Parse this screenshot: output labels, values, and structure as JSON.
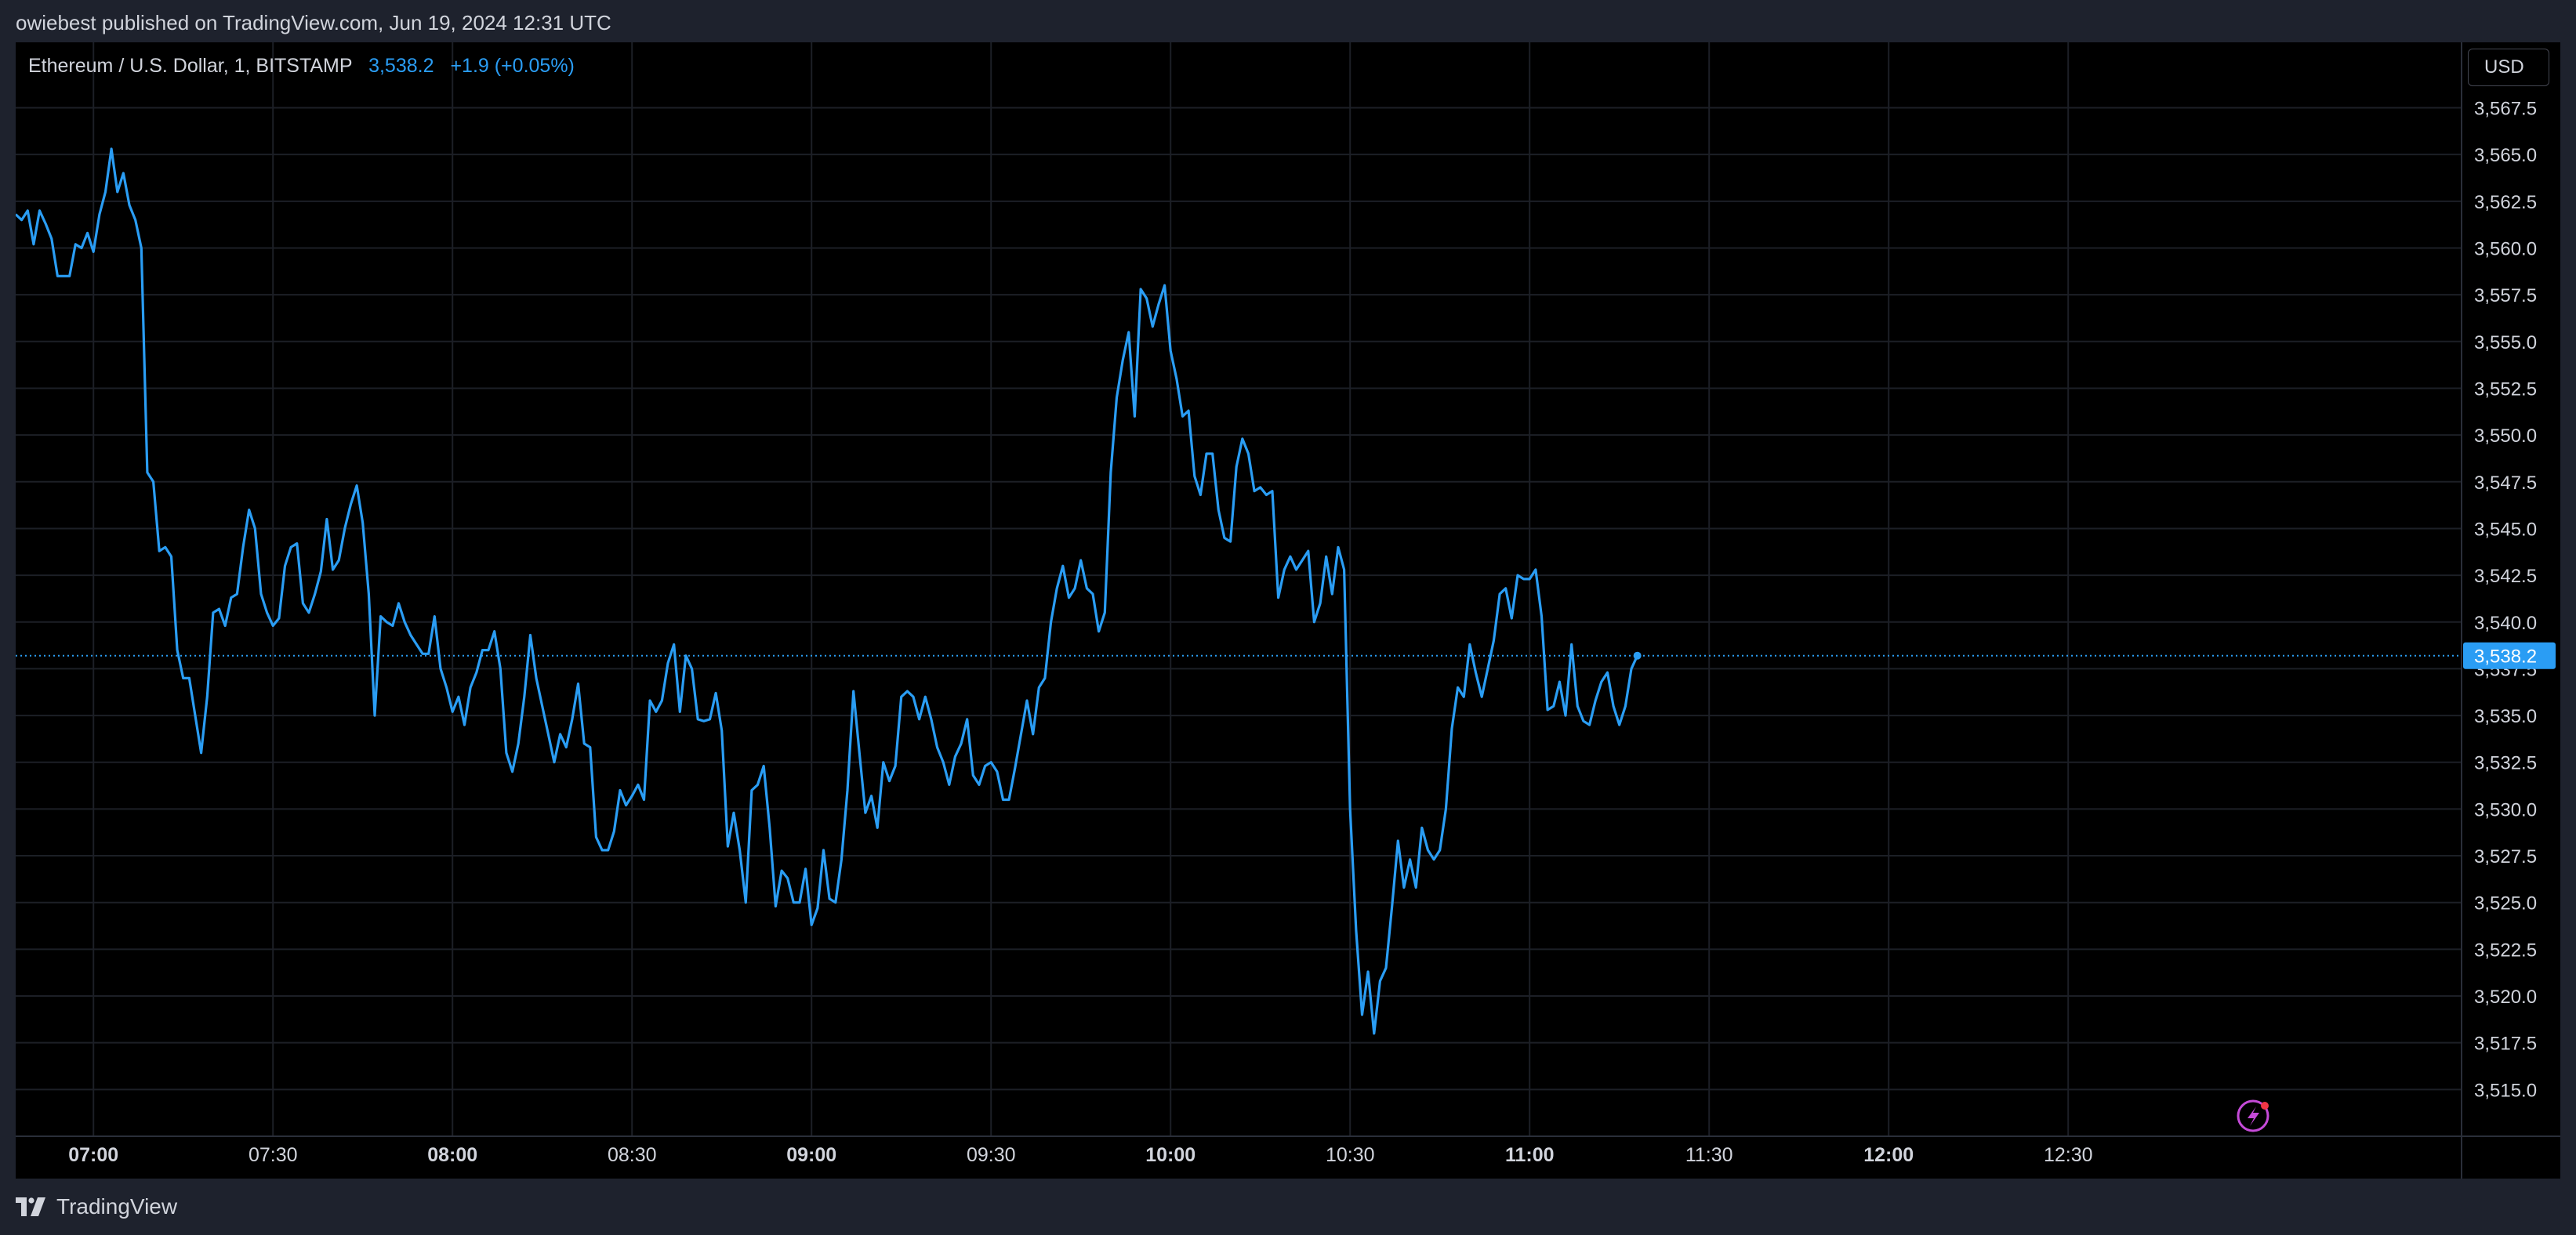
{
  "header": {
    "published_line": "owiebest published on TradingView.com, Jun 19, 2024 12:31 UTC"
  },
  "legend": {
    "symbol_text": "Ethereum / U.S. Dollar, 1, BITSTAMP",
    "last_price": "3,538.2",
    "change": "+1.9 (+0.05%)"
  },
  "currency_button": {
    "label": "USD"
  },
  "footer": {
    "brand": "TradingView",
    "logo_icon": "tradingview-logo-icon"
  },
  "colors": {
    "line": "#2a9df4",
    "price_tag_bg": "#2a9df4",
    "grid": "#1c1f26",
    "axis_text": "#d1d4dc",
    "background": "#000000",
    "frame": "#1e222d"
  },
  "chart_data": {
    "type": "line",
    "title": "",
    "xlabel": "",
    "ylabel": "",
    "x_unit": "minutes since 06:47 UTC",
    "ylim": [
      3512.5,
      3571
    ],
    "xlim": [
      0,
      271
    ],
    "grid": true,
    "y_ticks": [
      3515.0,
      3517.5,
      3520.0,
      3522.5,
      3525.0,
      3527.5,
      3530.0,
      3532.5,
      3535.0,
      3537.5,
      3540.0,
      3542.5,
      3545.0,
      3547.5,
      3550.0,
      3552.5,
      3555.0,
      3557.5,
      3560.0,
      3562.5,
      3565.0,
      3567.5
    ],
    "y_tick_labels": [
      "3,515.0",
      "3,517.5",
      "3,520.0",
      "3,522.5",
      "3,525.0",
      "3,527.5",
      "3,530.0",
      "3,532.5",
      "3,535.0",
      "3,537.5",
      "3,540.0",
      "3,542.5",
      "3,545.0",
      "3,547.5",
      "3,550.0",
      "3,552.5",
      "3,555.0",
      "3,557.5",
      "3,560.0",
      "3,562.5",
      "3,565.0",
      "3,567.5"
    ],
    "x_ticks": [
      {
        "label": "07:00",
        "minute": 13,
        "bold": true
      },
      {
        "label": "07:30",
        "minute": 43,
        "bold": false
      },
      {
        "label": "08:00",
        "minute": 73,
        "bold": true
      },
      {
        "label": "08:30",
        "minute": 103,
        "bold": false
      },
      {
        "label": "09:00",
        "minute": 133,
        "bold": true
      },
      {
        "label": "09:30",
        "minute": 163,
        "bold": false
      },
      {
        "label": "10:00",
        "minute": 193,
        "bold": true
      },
      {
        "label": "10:30",
        "minute": 223,
        "bold": false
      },
      {
        "label": "11:00",
        "minute": 253,
        "bold": true
      },
      {
        "label": "11:30",
        "minute": 283,
        "bold": false
      },
      {
        "label": "12:00",
        "minute": 313,
        "bold": true
      },
      {
        "label": "12:30",
        "minute": 343,
        "bold": false
      }
    ],
    "last_value": 3538.2,
    "last_value_label": "3,538.2",
    "series": [
      {
        "values": [
          [
            0,
            3561.8
          ],
          [
            1,
            3561.5
          ],
          [
            2,
            3562.0
          ],
          [
            3,
            3560.2
          ],
          [
            4,
            3562.0
          ],
          [
            5,
            3561.3
          ],
          [
            6,
            3560.5
          ],
          [
            7,
            3558.5
          ],
          [
            8,
            3558.5
          ],
          [
            9,
            3558.5
          ],
          [
            10,
            3560.2
          ],
          [
            11,
            3560.0
          ],
          [
            12,
            3560.8
          ],
          [
            13,
            3559.8
          ],
          [
            14,
            3561.8
          ],
          [
            15,
            3563.0
          ],
          [
            16,
            3565.3
          ],
          [
            17,
            3563.0
          ],
          [
            18,
            3564.0
          ],
          [
            19,
            3562.3
          ],
          [
            20,
            3561.5
          ],
          [
            21,
            3560.0
          ],
          [
            22,
            3548.0
          ],
          [
            23,
            3547.5
          ],
          [
            24,
            3543.8
          ],
          [
            25,
            3544.0
          ],
          [
            26,
            3543.5
          ],
          [
            27,
            3538.5
          ],
          [
            28,
            3537.0
          ],
          [
            29,
            3537.0
          ],
          [
            30,
            3535.0
          ],
          [
            31,
            3533.0
          ],
          [
            32,
            3536.0
          ],
          [
            33,
            3540.5
          ],
          [
            34,
            3540.7
          ],
          [
            35,
            3539.8
          ],
          [
            36,
            3541.3
          ],
          [
            37,
            3541.5
          ],
          [
            38,
            3544.0
          ],
          [
            39,
            3546.0
          ],
          [
            40,
            3545.0
          ],
          [
            41,
            3541.5
          ],
          [
            42,
            3540.5
          ],
          [
            43,
            3539.8
          ],
          [
            44,
            3540.2
          ],
          [
            45,
            3543.0
          ],
          [
            46,
            3544.0
          ],
          [
            47,
            3544.2
          ],
          [
            48,
            3541.0
          ],
          [
            49,
            3540.5
          ],
          [
            50,
            3541.5
          ],
          [
            51,
            3542.7
          ],
          [
            52,
            3545.5
          ],
          [
            53,
            3542.8
          ],
          [
            54,
            3543.3
          ],
          [
            55,
            3545.0
          ],
          [
            56,
            3546.3
          ],
          [
            57,
            3547.3
          ],
          [
            58,
            3545.3
          ],
          [
            59,
            3541.5
          ],
          [
            60,
            3535.0
          ],
          [
            61,
            3540.3
          ],
          [
            62,
            3540.0
          ],
          [
            63,
            3539.8
          ],
          [
            64,
            3541.0
          ],
          [
            65,
            3540.0
          ],
          [
            66,
            3539.3
          ],
          [
            67,
            3538.8
          ],
          [
            68,
            3538.3
          ],
          [
            69,
            3538.3
          ],
          [
            70,
            3540.3
          ],
          [
            71,
            3537.5
          ],
          [
            72,
            3536.5
          ],
          [
            73,
            3535.2
          ],
          [
            74,
            3536.0
          ],
          [
            75,
            3534.5
          ],
          [
            76,
            3536.5
          ],
          [
            77,
            3537.3
          ],
          [
            78,
            3538.5
          ],
          [
            79,
            3538.5
          ],
          [
            80,
            3539.5
          ],
          [
            81,
            3537.5
          ],
          [
            82,
            3533.0
          ],
          [
            83,
            3532.0
          ],
          [
            84,
            3533.5
          ],
          [
            85,
            3536.0
          ],
          [
            86,
            3539.3
          ],
          [
            87,
            3537.0
          ],
          [
            88,
            3535.5
          ],
          [
            89,
            3534.0
          ],
          [
            90,
            3532.5
          ],
          [
            91,
            3534.0
          ],
          [
            92,
            3533.3
          ],
          [
            93,
            3534.8
          ],
          [
            94,
            3536.7
          ],
          [
            95,
            3533.5
          ],
          [
            96,
            3533.3
          ],
          [
            97,
            3528.5
          ],
          [
            98,
            3527.8
          ],
          [
            99,
            3527.8
          ],
          [
            100,
            3528.8
          ],
          [
            101,
            3531.0
          ],
          [
            102,
            3530.2
          ],
          [
            103,
            3530.7
          ],
          [
            104,
            3531.3
          ],
          [
            105,
            3530.5
          ],
          [
            106,
            3535.8
          ],
          [
            107,
            3535.2
          ],
          [
            108,
            3535.8
          ],
          [
            109,
            3537.8
          ],
          [
            110,
            3538.8
          ],
          [
            111,
            3535.2
          ],
          [
            112,
            3538.2
          ],
          [
            113,
            3537.5
          ],
          [
            114,
            3534.8
          ],
          [
            115,
            3534.7
          ],
          [
            116,
            3534.8
          ],
          [
            117,
            3536.2
          ],
          [
            118,
            3534.2
          ],
          [
            119,
            3528.0
          ],
          [
            120,
            3529.8
          ],
          [
            121,
            3527.8
          ],
          [
            122,
            3525.0
          ],
          [
            123,
            3531.0
          ],
          [
            124,
            3531.3
          ],
          [
            125,
            3532.3
          ],
          [
            126,
            3529.0
          ],
          [
            127,
            3524.8
          ],
          [
            128,
            3526.7
          ],
          [
            129,
            3526.3
          ],
          [
            130,
            3525.0
          ],
          [
            131,
            3525.0
          ],
          [
            132,
            3526.8
          ],
          [
            133,
            3523.8
          ],
          [
            134,
            3524.7
          ],
          [
            135,
            3527.8
          ],
          [
            136,
            3525.2
          ],
          [
            137,
            3525.0
          ],
          [
            138,
            3527.3
          ],
          [
            139,
            3531.0
          ],
          [
            140,
            3536.3
          ],
          [
            141,
            3533.0
          ],
          [
            142,
            3529.8
          ],
          [
            143,
            3530.7
          ],
          [
            144,
            3529.0
          ],
          [
            145,
            3532.5
          ],
          [
            146,
            3531.5
          ],
          [
            147,
            3532.3
          ],
          [
            148,
            3536.0
          ],
          [
            149,
            3536.3
          ],
          [
            150,
            3536.0
          ],
          [
            151,
            3534.8
          ],
          [
            152,
            3536.0
          ],
          [
            153,
            3534.8
          ],
          [
            154,
            3533.3
          ],
          [
            155,
            3532.5
          ],
          [
            156,
            3531.3
          ],
          [
            157,
            3532.8
          ],
          [
            158,
            3533.5
          ],
          [
            159,
            3534.8
          ],
          [
            160,
            3531.8
          ],
          [
            161,
            3531.3
          ],
          [
            162,
            3532.3
          ],
          [
            163,
            3532.5
          ],
          [
            164,
            3532.0
          ],
          [
            165,
            3530.5
          ],
          [
            166,
            3530.5
          ],
          [
            167,
            3532.2
          ],
          [
            168,
            3534.0
          ],
          [
            169,
            3535.8
          ],
          [
            170,
            3534.0
          ],
          [
            171,
            3536.5
          ],
          [
            172,
            3537.0
          ],
          [
            173,
            3540.0
          ],
          [
            174,
            3541.8
          ],
          [
            175,
            3543.0
          ],
          [
            176,
            3541.3
          ],
          [
            177,
            3541.8
          ],
          [
            178,
            3543.3
          ],
          [
            179,
            3541.8
          ],
          [
            180,
            3541.5
          ],
          [
            181,
            3539.5
          ],
          [
            182,
            3540.5
          ],
          [
            183,
            3548.0
          ],
          [
            184,
            3552.0
          ],
          [
            185,
            3554.0
          ],
          [
            186,
            3555.5
          ],
          [
            187,
            3551.0
          ],
          [
            188,
            3557.8
          ],
          [
            189,
            3557.3
          ],
          [
            190,
            3555.8
          ],
          [
            191,
            3557.0
          ],
          [
            192,
            3558.0
          ],
          [
            193,
            3554.5
          ],
          [
            194,
            3553.0
          ],
          [
            195,
            3551.0
          ],
          [
            196,
            3551.3
          ],
          [
            197,
            3547.8
          ],
          [
            198,
            3546.8
          ],
          [
            199,
            3549.0
          ],
          [
            200,
            3549.0
          ],
          [
            201,
            3546.0
          ],
          [
            202,
            3544.5
          ],
          [
            203,
            3544.3
          ],
          [
            204,
            3548.3
          ],
          [
            205,
            3549.8
          ],
          [
            206,
            3549.0
          ],
          [
            207,
            3547.0
          ],
          [
            208,
            3547.2
          ],
          [
            209,
            3546.8
          ],
          [
            210,
            3547.0
          ],
          [
            211,
            3541.3
          ],
          [
            212,
            3542.8
          ],
          [
            213,
            3543.5
          ],
          [
            214,
            3542.8
          ],
          [
            215,
            3543.3
          ],
          [
            216,
            3543.8
          ],
          [
            217,
            3540.0
          ],
          [
            218,
            3541.0
          ],
          [
            219,
            3543.5
          ],
          [
            220,
            3541.5
          ],
          [
            221,
            3544.0
          ],
          [
            222,
            3542.8
          ],
          [
            223,
            3530.0
          ],
          [
            224,
            3523.5
          ],
          [
            225,
            3519.0
          ],
          [
            226,
            3521.3
          ],
          [
            227,
            3518.0
          ],
          [
            228,
            3520.8
          ],
          [
            229,
            3521.5
          ],
          [
            230,
            3524.8
          ],
          [
            231,
            3528.3
          ],
          [
            232,
            3525.8
          ],
          [
            233,
            3527.3
          ],
          [
            234,
            3525.8
          ],
          [
            235,
            3529.0
          ],
          [
            236,
            3527.8
          ],
          [
            237,
            3527.3
          ],
          [
            238,
            3527.8
          ],
          [
            239,
            3530.0
          ],
          [
            240,
            3534.3
          ],
          [
            241,
            3536.5
          ],
          [
            242,
            3536.0
          ],
          [
            243,
            3538.8
          ],
          [
            244,
            3537.3
          ],
          [
            245,
            3536.0
          ],
          [
            246,
            3537.5
          ],
          [
            247,
            3539.0
          ],
          [
            248,
            3541.5
          ],
          [
            249,
            3541.8
          ],
          [
            250,
            3540.2
          ],
          [
            251,
            3542.5
          ],
          [
            252,
            3542.3
          ],
          [
            253,
            3542.3
          ],
          [
            254,
            3542.8
          ],
          [
            255,
            3540.3
          ],
          [
            256,
            3535.3
          ],
          [
            257,
            3535.5
          ],
          [
            258,
            3536.8
          ],
          [
            259,
            3535.0
          ],
          [
            260,
            3538.8
          ],
          [
            261,
            3535.5
          ],
          [
            262,
            3534.7
          ],
          [
            263,
            3534.5
          ],
          [
            264,
            3535.8
          ],
          [
            265,
            3536.8
          ],
          [
            266,
            3537.3
          ],
          [
            267,
            3535.5
          ],
          [
            268,
            3534.5
          ],
          [
            269,
            3535.5
          ],
          [
            270,
            3537.5
          ],
          [
            271,
            3538.2
          ]
        ]
      }
    ]
  }
}
